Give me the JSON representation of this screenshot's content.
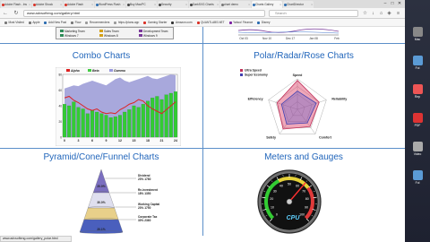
{
  "tabs": [
    {
      "label": "Adobe Flash - Ins",
      "color": "#d93025"
    },
    {
      "label": "Adobe Shock",
      "color": "#d93025"
    },
    {
      "label": "Adobe Flash",
      "color": "#d93025"
    },
    {
      "label": "WordPress Flash",
      "color": "#2b6cb0"
    },
    {
      "label": "Buy Mac/PC",
      "color": "#444"
    },
    {
      "label": "Security",
      "color": "#444"
    },
    {
      "label": "DarkSVG Charts",
      "color": "#444"
    },
    {
      "label": "chart demo",
      "color": "#777"
    },
    {
      "label": "Charts Gallery",
      "color": "#2b6cb0"
    },
    {
      "label": "ChartDirector",
      "color": "#2b6cb0"
    }
  ],
  "address": {
    "url": "www.advsofteng.com/gallery.html",
    "search_placeholder": "Search"
  },
  "bookmarks": [
    {
      "label": "Most Visited",
      "color": "#777"
    },
    {
      "label": "Apple",
      "color": "#777"
    },
    {
      "label": "Add New Post",
      "color": "#2b6cb0"
    },
    {
      "label": "Flow",
      "color": "#777"
    },
    {
      "label": "Recommenders",
      "color": "#999"
    },
    {
      "label": "https://plans.app",
      "color": "#999"
    },
    {
      "label": "Gaming Starter",
      "color": "#d93025"
    },
    {
      "label": "Amazon.com",
      "color": "#333"
    },
    {
      "label": "QUANTLABS.NET",
      "color": "#d93025"
    },
    {
      "label": "Yahoo! Finance",
      "color": "#7b1fa2"
    },
    {
      "label": "Disney",
      "color": "#2b6cb0"
    }
  ],
  "top_legend": [
    "Marketing Team",
    "Sales Team",
    "Development Team",
    "Windows 7",
    "Windows 8",
    "Windows 9"
  ],
  "sections": {
    "combo": "Combo Charts",
    "polar": "Polar/Radar/Rose Charts",
    "pyramid": "Pyramid/Cone/Funnel Charts",
    "meters": "Meters and Gauges"
  },
  "top_right_axis": [
    "Oct 03",
    "Nov 10",
    "Dec 17",
    "Jan 08",
    "Feb"
  ],
  "combo_chart": {
    "legend": [
      "Alpha",
      "Beta",
      "Gamma"
    ],
    "legend_colors": [
      "#dd2222",
      "#44cc44",
      "#9999dd"
    ],
    "x_labels": [
      "0",
      "3",
      "6",
      "9",
      "12",
      "15",
      "18",
      "21",
      "24"
    ],
    "y_labels": [
      "80",
      "60",
      "40",
      "20",
      "0"
    ],
    "alpha": [
      50,
      52,
      47,
      44,
      40,
      36,
      34,
      36,
      32,
      30,
      31,
      30,
      35,
      38,
      42,
      44,
      48,
      46,
      40,
      36,
      33,
      30,
      35,
      40,
      45
    ],
    "beta": [
      42,
      40,
      45,
      38,
      36,
      30,
      34,
      32,
      30,
      28,
      25,
      26,
      28,
      32,
      35,
      40,
      38,
      42,
      46,
      50,
      52,
      48,
      54,
      56,
      58
    ],
    "gamma": [
      62,
      64,
      66,
      65,
      68,
      70,
      72,
      70,
      68,
      66,
      70,
      74,
      76,
      72,
      70,
      72,
      74,
      76,
      78,
      75,
      74,
      76,
      78,
      80,
      79
    ]
  },
  "radar_chart": {
    "legend": [
      "Ultra Speed",
      "Super Economy"
    ],
    "axes": [
      "Speed",
      "Reliability",
      "Comfort",
      "Safety",
      "Efficiency"
    ],
    "ultra": [
      0.95,
      0.75,
      0.7,
      0.8,
      0.7
    ],
    "economy": [
      0.6,
      0.65,
      0.55,
      0.6,
      0.55
    ]
  },
  "pyramid_chart": {
    "labels": [
      "Dividend\n23% 1780",
      "Re-investment\n18% 1350",
      "Working Capital\n23% 1750",
      "Corporate Tax\n30% 2360"
    ],
    "values": [
      "20.0%",
      "30.0%",
      "20.1%"
    ]
  },
  "gauge": {
    "label": "CPU",
    "value": 65,
    "ticks": [
      "0",
      "10",
      "20",
      "30",
      "40",
      "50",
      "60",
      "70",
      "80",
      "90",
      "100"
    ]
  },
  "status_url": "www.advsofteng.com/gallery_polar.html",
  "desktop_icons": [
    {
      "label": "Mac",
      "color": "#888"
    },
    {
      "label": "Fol",
      "color": "#5b9bd5"
    },
    {
      "label": "Rep",
      "color": "#e55"
    },
    {
      "label": "PDF",
      "color": "#d33"
    },
    {
      "label": "Video",
      "color": "#aaa"
    },
    {
      "label": "Fol",
      "color": "#5b9bd5"
    }
  ]
}
